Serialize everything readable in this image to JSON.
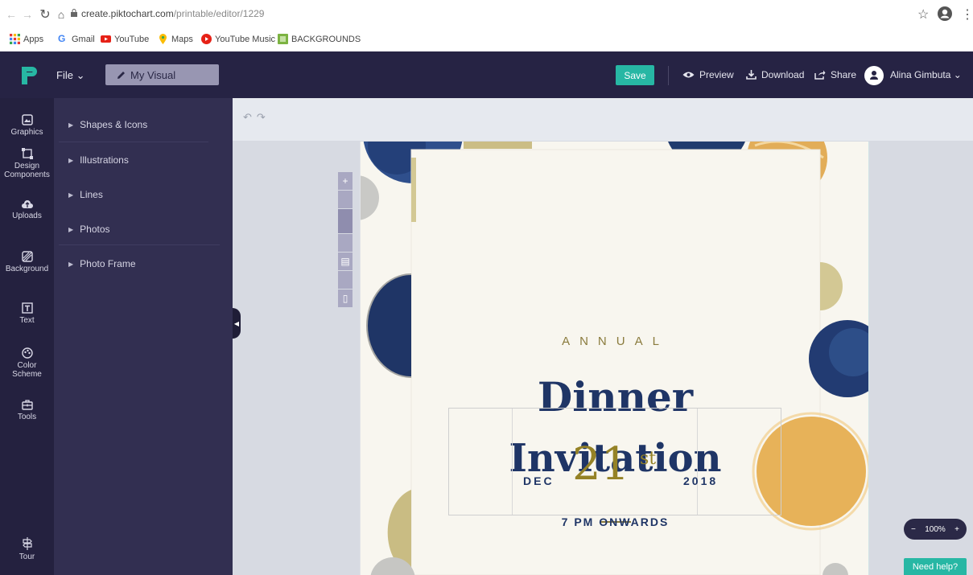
{
  "browser": {
    "url_host": "create.piktochart.com",
    "url_path": "/printable/editor/1229",
    "bookmarks": [
      {
        "label": "Apps",
        "icon": "apps-grid-icon",
        "color": "#e53935"
      },
      {
        "label": "Gmail",
        "icon": "google-icon",
        "color": "#4285f4"
      },
      {
        "label": "YouTube",
        "icon": "youtube-icon",
        "color": "#e62117"
      },
      {
        "label": "Maps",
        "icon": "maps-pin-icon",
        "color": "#34a853"
      },
      {
        "label": "YouTube Music",
        "icon": "youtube-music-icon",
        "color": "#e62117"
      },
      {
        "label": "BACKGROUNDS",
        "icon": "folder-icon",
        "color": "#7cb342"
      }
    ]
  },
  "app": {
    "file_menu": "File",
    "doc_title": "My Visual",
    "save": "Save",
    "preview": "Preview",
    "download": "Download",
    "share": "Share",
    "user_name": "Alina Gimbuta",
    "accent": "#27b7a4"
  },
  "rail": [
    {
      "label": "Graphics",
      "icon": "graphics-icon"
    },
    {
      "label": "Design Components",
      "icon": "design-components-icon"
    },
    {
      "label": "Uploads",
      "icon": "uploads-icon"
    },
    {
      "label": "Background",
      "icon": "background-icon"
    },
    {
      "label": "Text",
      "icon": "text-icon"
    },
    {
      "label": "Color Scheme",
      "icon": "color-scheme-icon"
    },
    {
      "label": "Tools",
      "icon": "tools-icon"
    },
    {
      "label": "Tour",
      "icon": "tour-icon"
    }
  ],
  "panel": {
    "items": [
      "Shapes & Icons",
      "Illustrations",
      "Lines",
      "Photos",
      "Photo Frame"
    ]
  },
  "design": {
    "annual": "ANNUAL",
    "title_line1": "Dinner",
    "title_line2": "Invitation",
    "month": "DEC",
    "day": "21",
    "day_suffix": "st",
    "year": "2018",
    "time": "7 PM ONWARDS",
    "navy": "#1f3566",
    "gold": "#958226"
  },
  "zoom": {
    "minus": "−",
    "level": "100%",
    "plus": "+"
  },
  "help": "Need help?"
}
